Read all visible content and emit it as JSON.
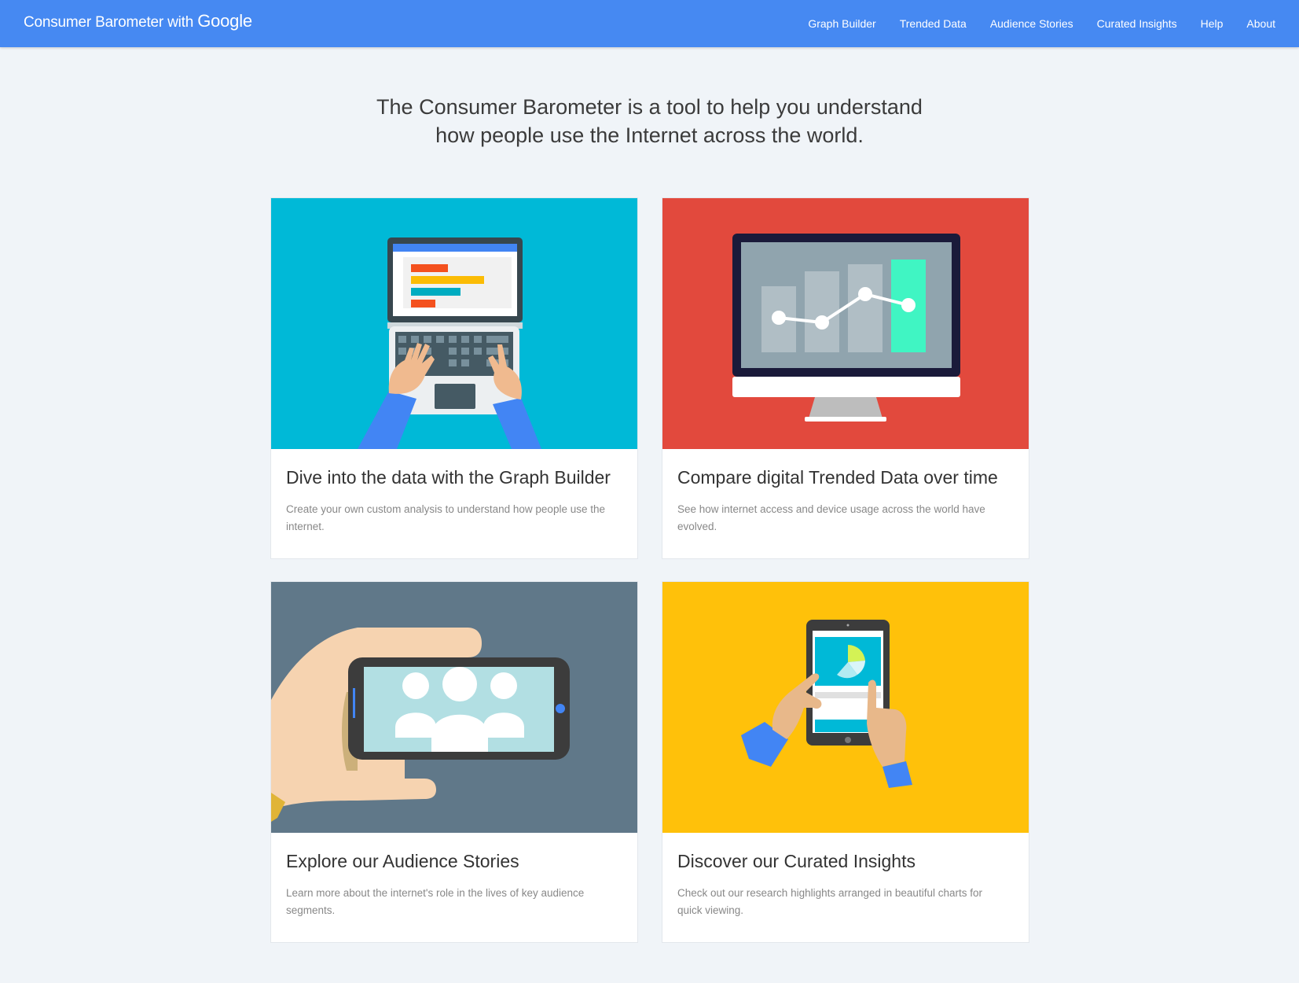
{
  "header": {
    "brand_prefix": "Consumer Barometer with",
    "brand_google": "Google",
    "nav": [
      "Graph Builder",
      "Trended Data",
      "Audience Stories",
      "Curated Insights",
      "Help",
      "About"
    ]
  },
  "intro": {
    "line1": "The Consumer Barometer is a tool to help you understand",
    "line2": "how people use the Internet across the world."
  },
  "cards": [
    {
      "title": "Dive into the data with the Graph Builder",
      "description": "Create your own custom analysis to understand how people use the internet.",
      "bg_color": "#00b9d7",
      "illustration": "laptop-typing-icon"
    },
    {
      "title": "Compare digital Trended Data over time",
      "description": "See how internet access and device usage across the world have evolved.",
      "bg_color": "#e2493d",
      "illustration": "monitor-chart-icon"
    },
    {
      "title": "Explore our Audience Stories",
      "description": "Learn more about the internet's role in the lives of key audience segments.",
      "bg_color": "#607889",
      "illustration": "phone-audience-icon"
    },
    {
      "title": "Discover our Curated Insights",
      "description": "Check out our research highlights arranged in beautiful charts for quick viewing.",
      "bg_color": "#ffc10a",
      "illustration": "tablet-insights-icon"
    }
  ],
  "colors": {
    "header": "#4689f2",
    "page_bg": "#f0f4f8"
  }
}
